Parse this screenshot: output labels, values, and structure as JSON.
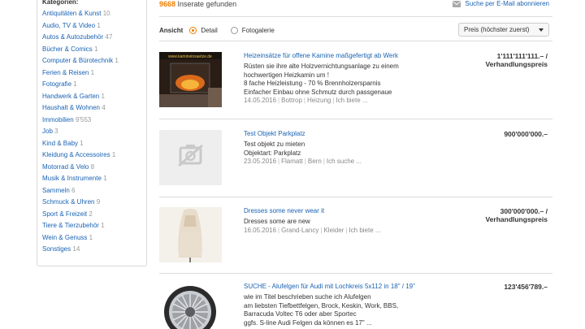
{
  "sidebar": {
    "heading": "Kategorien:",
    "categories": [
      {
        "label": "Antiquitäten & Kunst",
        "count": "10"
      },
      {
        "label": "Audio, TV & Video",
        "count": "1"
      },
      {
        "label": "Autos & Autozubehör",
        "count": "47"
      },
      {
        "label": "Bücher & Comics",
        "count": "1"
      },
      {
        "label": "Computer & Bürotechnik",
        "count": "1"
      },
      {
        "label": "Ferien & Reisen",
        "count": "1"
      },
      {
        "label": "Fotografie",
        "count": "1"
      },
      {
        "label": "Handwerk & Garten",
        "count": "1"
      },
      {
        "label": "Haushalt & Wohnen",
        "count": "4"
      },
      {
        "label": "Immobilien",
        "count": "9'553"
      },
      {
        "label": "Job",
        "count": "3"
      },
      {
        "label": "Kind & Baby",
        "count": "1"
      },
      {
        "label": "Kleidung & Accessoires",
        "count": "1"
      },
      {
        "label": "Motorrad & Velo",
        "count": "8"
      },
      {
        "label": "Musik & Instrumente",
        "count": "1"
      },
      {
        "label": "Sammeln",
        "count": "6"
      },
      {
        "label": "Schmuck & Uhren",
        "count": "9"
      },
      {
        "label": "Sport & Freizeit",
        "count": "2"
      },
      {
        "label": "Tiere & Tierzubehör",
        "count": "1"
      },
      {
        "label": "Wein & Genuss",
        "count": "1"
      },
      {
        "label": "Sonstiges",
        "count": "14"
      }
    ]
  },
  "results": {
    "count": "9668",
    "label": "Inserate gefunden",
    "email_alert": "Suche per E-Mail abonnieren"
  },
  "view": {
    "label": "Ansicht",
    "options": [
      "Detail",
      "Fotogalerie"
    ],
    "selected": "Detail",
    "sort_label": "Preis (höchster zuerst)"
  },
  "listings": [
    {
      "title": "Heizeinsätze für offene Kamine maßgefertigt ab Werk",
      "lines": [
        "Rüsten sie ihre alte Holzvernichtungsanlage zu einem",
        "hochwertigen Heizkamin um !",
        "8 fache Heizleistung - 70 % Brennholzersparnis",
        "Einfacher Einbau ohne Schmutz durch passgenaue"
      ],
      "date": "14.05.2016",
      "location": "Bottrop",
      "category": "Heizung",
      "more": "Ich biete ...",
      "price": "1'111'111'111.– /",
      "price_note": "Verhandlungspreis",
      "image": "fireplace",
      "image_text": "www.kamineinsaetze.de"
    },
    {
      "title": "Test Objekt Parkplatz",
      "lines": [
        "Test objekt zu mieten",
        "Objektart: Parkplatz"
      ],
      "date": "23.05.2016",
      "location": "Flamatt",
      "category": "Bern",
      "more": "Ich suche ...",
      "price": "900'000'000.–",
      "price_note": "",
      "image": "placeholder"
    },
    {
      "title": "Dresses some never wear it",
      "lines": [
        "Dresses some are new"
      ],
      "date": "16.05.2016",
      "location": "Grand-Lancy",
      "category": "Kleider",
      "more": "Ich biete ...",
      "price": "300'000'000.– /",
      "price_note": "Verhandlungspreis",
      "image": "dress"
    },
    {
      "title": "SUCHE - Alufelgen für Audi mit Lochkreis 5x112 in 18\" / 19\"",
      "lines": [
        "wie im Titel beschrieben suche ich Alufelgen",
        "am liebsten Tiefbettfelgen, Brock, Keskin, Work, BBS,",
        "Barracuda Voltec T6 oder aber Sportec",
        "ggfs. S-line Audi Felgen da können es 17\" ..."
      ],
      "date": "",
      "location": "",
      "category": "",
      "more": "",
      "price": "123'456'789.–",
      "price_note": "",
      "image": "wheel"
    }
  ],
  "colors": {
    "link": "#1a63b3",
    "accent": "#f07d00"
  }
}
